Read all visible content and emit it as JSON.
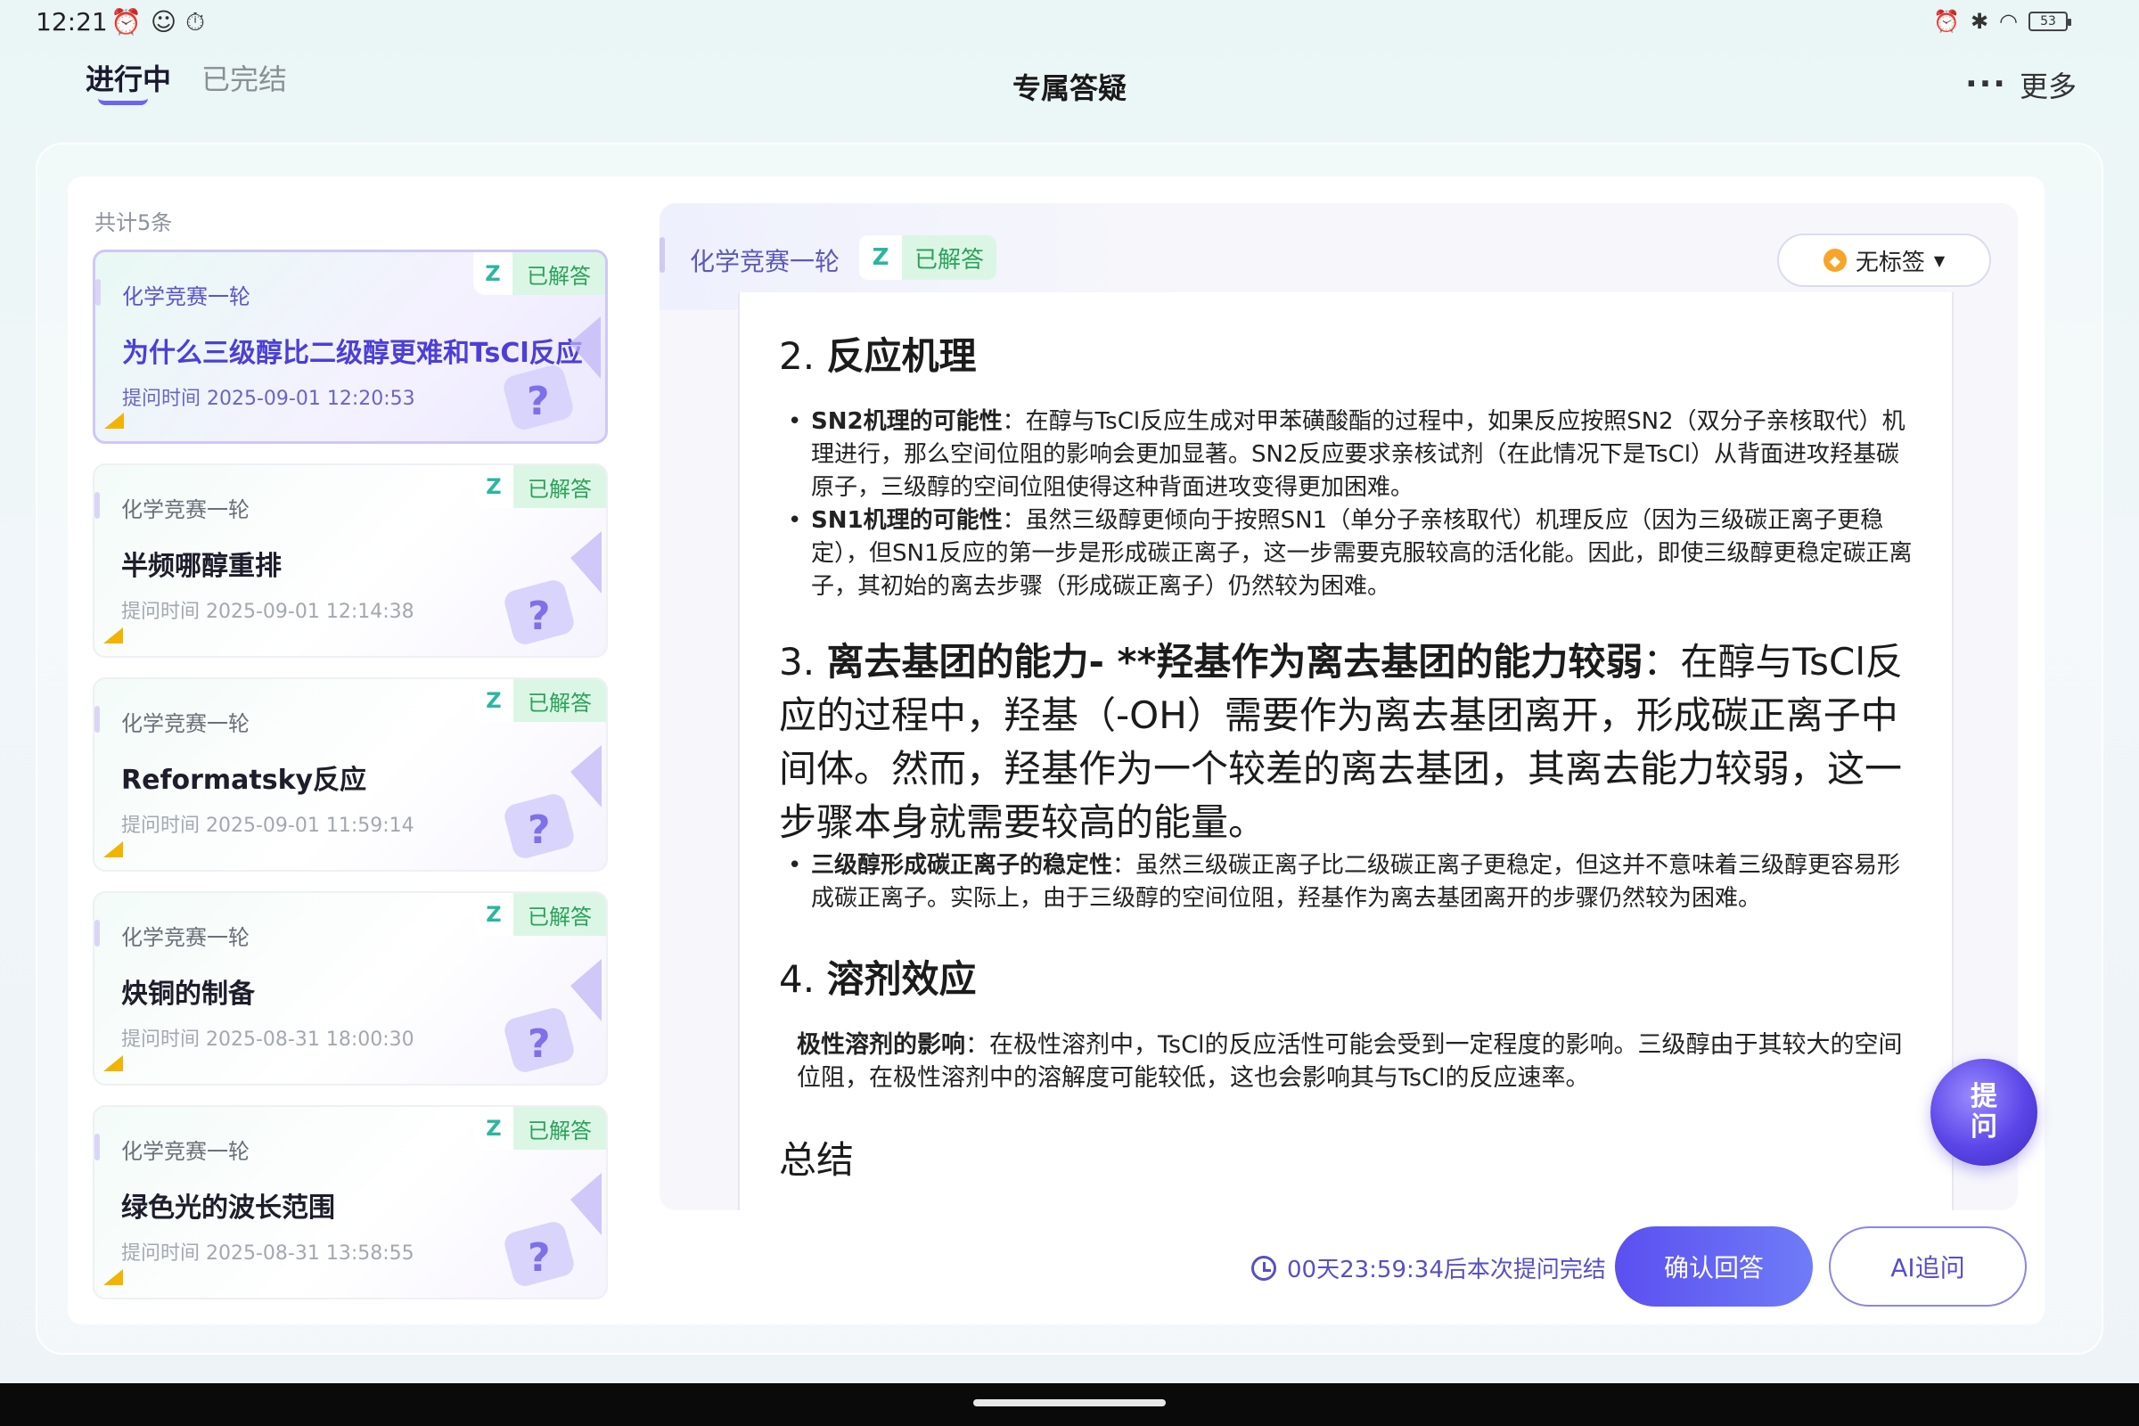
{
  "status_bar": {
    "time": "12:21",
    "left_icons": [
      "alarm-icon",
      "app-icon",
      "timer-icon"
    ],
    "right_icons": [
      "alarm-icon",
      "bluetooth-icon",
      "wifi-icon"
    ],
    "battery": "53"
  },
  "header": {
    "tabs": [
      {
        "label": "进行中",
        "active": true
      },
      {
        "label": "已完结",
        "active": false
      }
    ],
    "title": "专属答疑",
    "more_label": "更多"
  },
  "list": {
    "count_label": "共计5条",
    "cards": [
      {
        "category": "化学竞赛一轮",
        "badge_z": "Z",
        "status": "已解答",
        "title": "为什么三级醇比二级醇更难和TsCl反应",
        "time": "提问时间 2025-09-01 12:20:53",
        "active": true
      },
      {
        "category": "化学竞赛一轮",
        "badge_z": "Z",
        "status": "已解答",
        "title": "半频哪醇重排",
        "time": "提问时间 2025-09-01 12:14:38",
        "active": false
      },
      {
        "category": "化学竞赛一轮",
        "badge_z": "Z",
        "status": "已解答",
        "title": "Reformatsky反应",
        "time": "提问时间 2025-09-01 11:59:14",
        "active": false
      },
      {
        "category": "化学竞赛一轮",
        "badge_z": "Z",
        "status": "已解答",
        "title": "炔铜的制备",
        "time": "提问时间 2025-08-31 18:00:30",
        "active": false
      },
      {
        "category": "化学竞赛一轮",
        "badge_z": "Z",
        "status": "已解答",
        "title": "绿色光的波长范围",
        "time": "提问时间 2025-08-31 13:58:55",
        "active": false
      }
    ]
  },
  "detail": {
    "category": "化学竞赛一轮",
    "badge_z": "Z",
    "status": "已解答",
    "tag_select": "无标签",
    "answer": {
      "h2_num": "2.",
      "h2_title": "反应机理",
      "sn2_label": "SN2机理的可能性",
      "sn2_text": "：在醇与TsCl反应生成对甲苯磺酸酯的过程中，如果反应按照SN2（双分子亲核取代）机理进行，那么空间位阻的影响会更加显著。SN2反应要求亲核试剂（在此情况下是TsCl）从背面进攻羟基碳原子，三级醇的空间位阻使得这种背面进攻变得更加困难。",
      "sn1_label": "SN1机理的可能性",
      "sn1_text": "：虽然三级醇更倾向于按照SN1（单分子亲核取代）机理反应（因为三级碳正离子更稳定），但SN1反应的第一步是形成碳正离子，这一步需要克服较高的活化能。因此，即使三级醇更稳定碳正离子，其初始的离去步骤（形成碳正离子）仍然较为困难。",
      "h3_num": "3.",
      "h3_bold": "离去基团的能力- **羟基作为离去基团的能力较弱",
      "h3_text": "：在醇与TsCl反应的过程中，羟基（-OH）需要作为离去基团离开，形成碳正离子中间体。然而，羟基作为一个较差的离去基团，其离去能力较弱，这一步骤本身就需要较高的能量。",
      "carb_label": "三级醇形成碳正离子的稳定性",
      "carb_text": "：虽然三级碳正离子比二级碳正离子更稳定，但这并不意味着三级醇更容易形成碳正离子。实际上，由于三级醇的空间位阻，羟基作为离去基团离开的步骤仍然较为困难。",
      "h4_num": "4.",
      "h4_title": "溶剂效应",
      "polar_label": "极性溶剂的影响",
      "polar_text": "：在极性溶剂中，TsCl的反应活性可能会受到一定程度的影响。三级醇由于其较大的空间位阻，在极性溶剂中的溶解度可能较低，这也会影响其与TsCl的反应速率。",
      "summary": "总结"
    },
    "ask_button": "提问"
  },
  "footer": {
    "timer_text": "00天23:59:34后本次提问完结",
    "confirm_label": "确认回答",
    "ai_label": "AI追问"
  },
  "colors": {
    "accent": "#5b4ff0",
    "success_bg": "#dcf6e5",
    "success_text": "#2aa35a",
    "teal": "#2bb6a0"
  }
}
